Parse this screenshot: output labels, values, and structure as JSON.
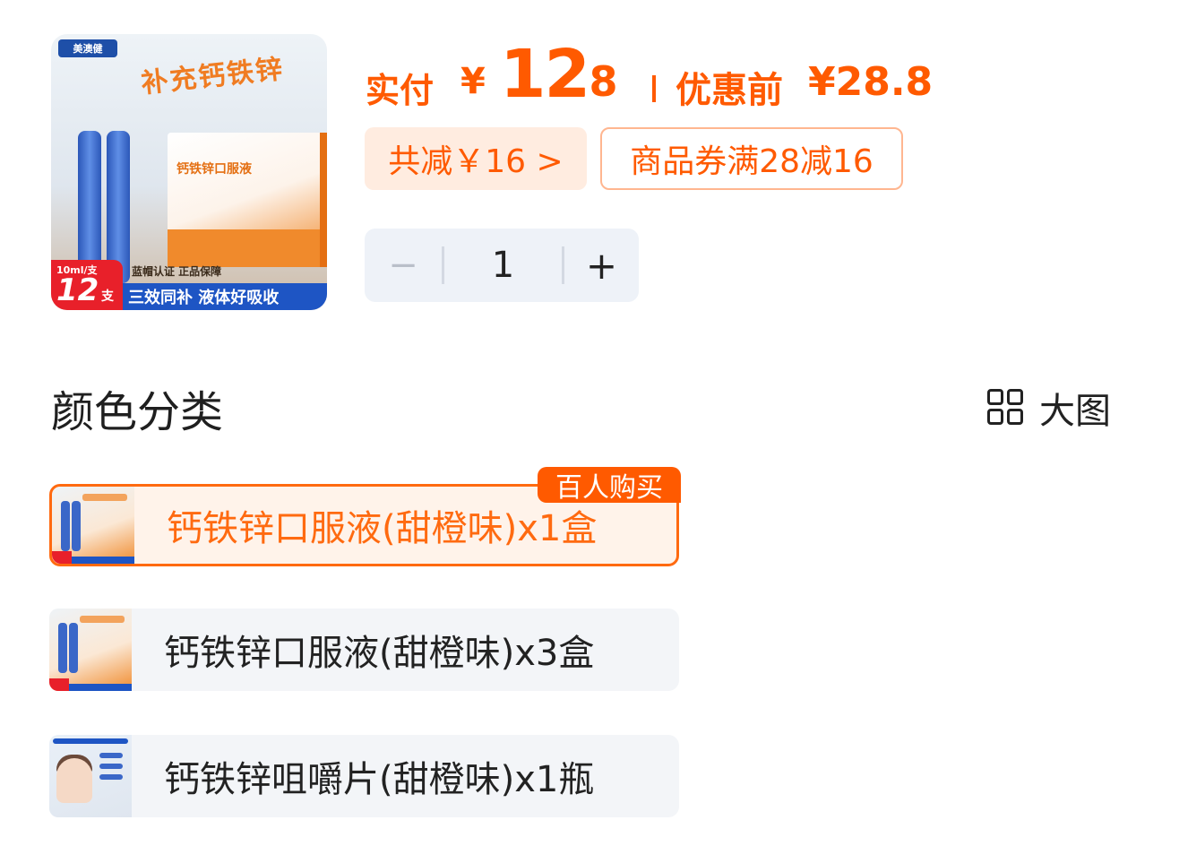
{
  "product_image": {
    "brand_logo": "美澳健",
    "headline": "补充钙铁锌",
    "box_label": "钙铁锌口服液",
    "note": "蓝帽认证 正品保障",
    "spec": "10ml/支",
    "count": "12",
    "count_unit": "支",
    "benefit": "三效同补 液体好吸收"
  },
  "price": {
    "label": "实付",
    "currency": "¥",
    "integer": "12",
    "decimal": ".8",
    "original_label": "优惠前",
    "original_value": "¥28.8"
  },
  "discounts": {
    "total": "共减￥16 >",
    "coupon": "商品券满28减16"
  },
  "quantity": {
    "minus": "−",
    "value": "1",
    "plus": "+"
  },
  "section": {
    "title": "颜色分类",
    "view_toggle": "大图"
  },
  "options": [
    {
      "name": "钙铁锌口服液(甜橙味)x1盒",
      "selected": true,
      "badge": "百人购买"
    },
    {
      "name": "钙铁锌口服液(甜橙味)x3盒",
      "selected": false
    },
    {
      "name": "钙铁锌咀嚼片(甜橙味)x1瓶",
      "selected": false
    }
  ],
  "colors": {
    "accent": "#ff5a00",
    "selected_border": "#ff6a10",
    "option_bg": "#f3f5f8"
  }
}
